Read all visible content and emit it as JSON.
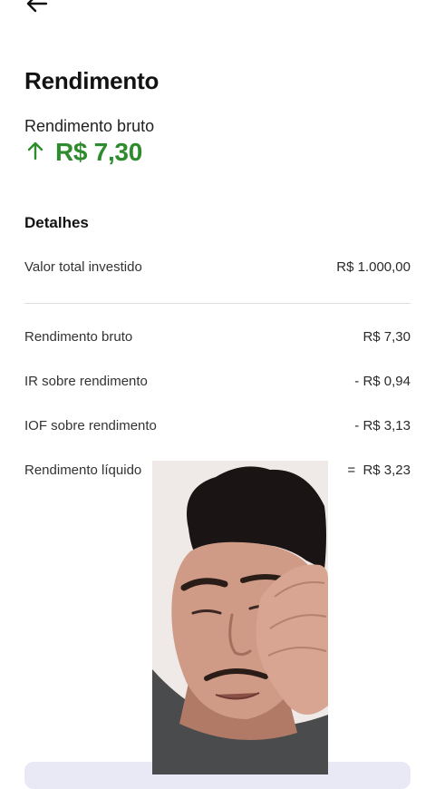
{
  "header": {
    "back_icon": "arrow-left-icon",
    "title": "Rendimento"
  },
  "summary": {
    "label": "Rendimento bruto",
    "trend_icon": "arrow-up-icon",
    "value": "R$ 7,30",
    "accent_color": "#2e8b2e"
  },
  "details": {
    "heading": "Detalhes",
    "rows": [
      {
        "label": "Valor total investido",
        "value": "R$ 1.000,00"
      },
      {
        "label": "Rendimento bruto",
        "value": "R$ 7,30"
      },
      {
        "label": "IR sobre rendimento",
        "value": "- R$ 0,94"
      },
      {
        "label": "IOF sobre rendimento",
        "value": "- R$ 3,13"
      },
      {
        "label": "Rendimento líquido",
        "value": "=  R$ 3,23"
      }
    ]
  }
}
